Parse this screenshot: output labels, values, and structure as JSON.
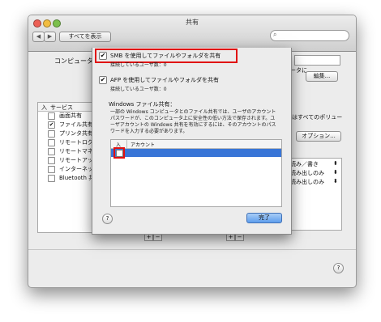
{
  "window": {
    "title": "共有",
    "show_all": "すべてを表示",
    "computer_name_label": "コンピュータ名:",
    "edit_button": "編集...",
    "partial_text": "ータに",
    "service_header": "サービス",
    "on_header": "入",
    "services": [
      {
        "label": "画面共有",
        "checked": false
      },
      {
        "label": "ファイル共有",
        "checked": true
      },
      {
        "label": "プリンタ共有",
        "checked": false
      },
      {
        "label": "リモートログイン",
        "checked": false
      },
      {
        "label": "リモートマネージメント",
        "checked": false
      },
      {
        "label": "リモートアップルイベント",
        "checked": false
      },
      {
        "label": "インターネット共有",
        "checked": false
      },
      {
        "label": "Bluetooth 共有",
        "checked": false
      }
    ],
    "right_text": "はすべてのポリュー",
    "options_button": "オプション...",
    "permissions": [
      "読み／書き",
      "読み出しのみ",
      "読み出しのみ"
    ],
    "add_symbol": "+",
    "remove_symbol": "−"
  },
  "sheet": {
    "smb_label": "SMB を使用してファイルやフォルダを共有",
    "smb_checked": true,
    "smb_connected": "接続しているユーザ数：0",
    "afp_label": "AFP を使用してファイルやフォルダを共有",
    "afp_checked": true,
    "afp_connected": "接続しているユーザ数：0",
    "windows_heading": "Windows ファイル共有：",
    "description": "一部の Windows コンピュータとのファイル共有では、ユーザのアカウントパスワードが、このコンピュータ上に安全性の低い方法で保存されます。ユーザアカウントの Windows 共有を有効にするには、そのアカウントのパスワードを入力する必要があります。",
    "table_on_header": "入",
    "table_account_header": "アカウント",
    "row_checked": false,
    "done_button": "完了",
    "help": "?"
  },
  "colors": {
    "highlight": "#3875d7",
    "red_outline": "#e01010",
    "done_blue": "#5d9ded"
  }
}
